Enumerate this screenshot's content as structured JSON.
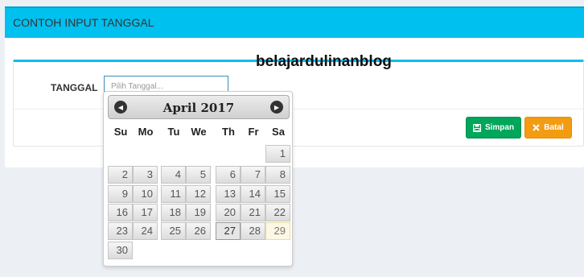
{
  "panel": {
    "title": "CONTOH INPUT TANGGAL"
  },
  "form": {
    "date_label": "TANGGAL",
    "date_placeholder": "Pilih Tanggal..."
  },
  "watermark": "belajardulinanblog",
  "buttons": {
    "save": "Simpan",
    "cancel": "Batal"
  },
  "datepicker": {
    "month_year": "April 2017",
    "weekdays": [
      "Su",
      "Mo",
      "Tu",
      "We",
      "Th",
      "Fr",
      "Sa"
    ],
    "first_weekday_index": 6,
    "days_in_month": 30,
    "active_day": 27,
    "today_day": 29
  }
}
